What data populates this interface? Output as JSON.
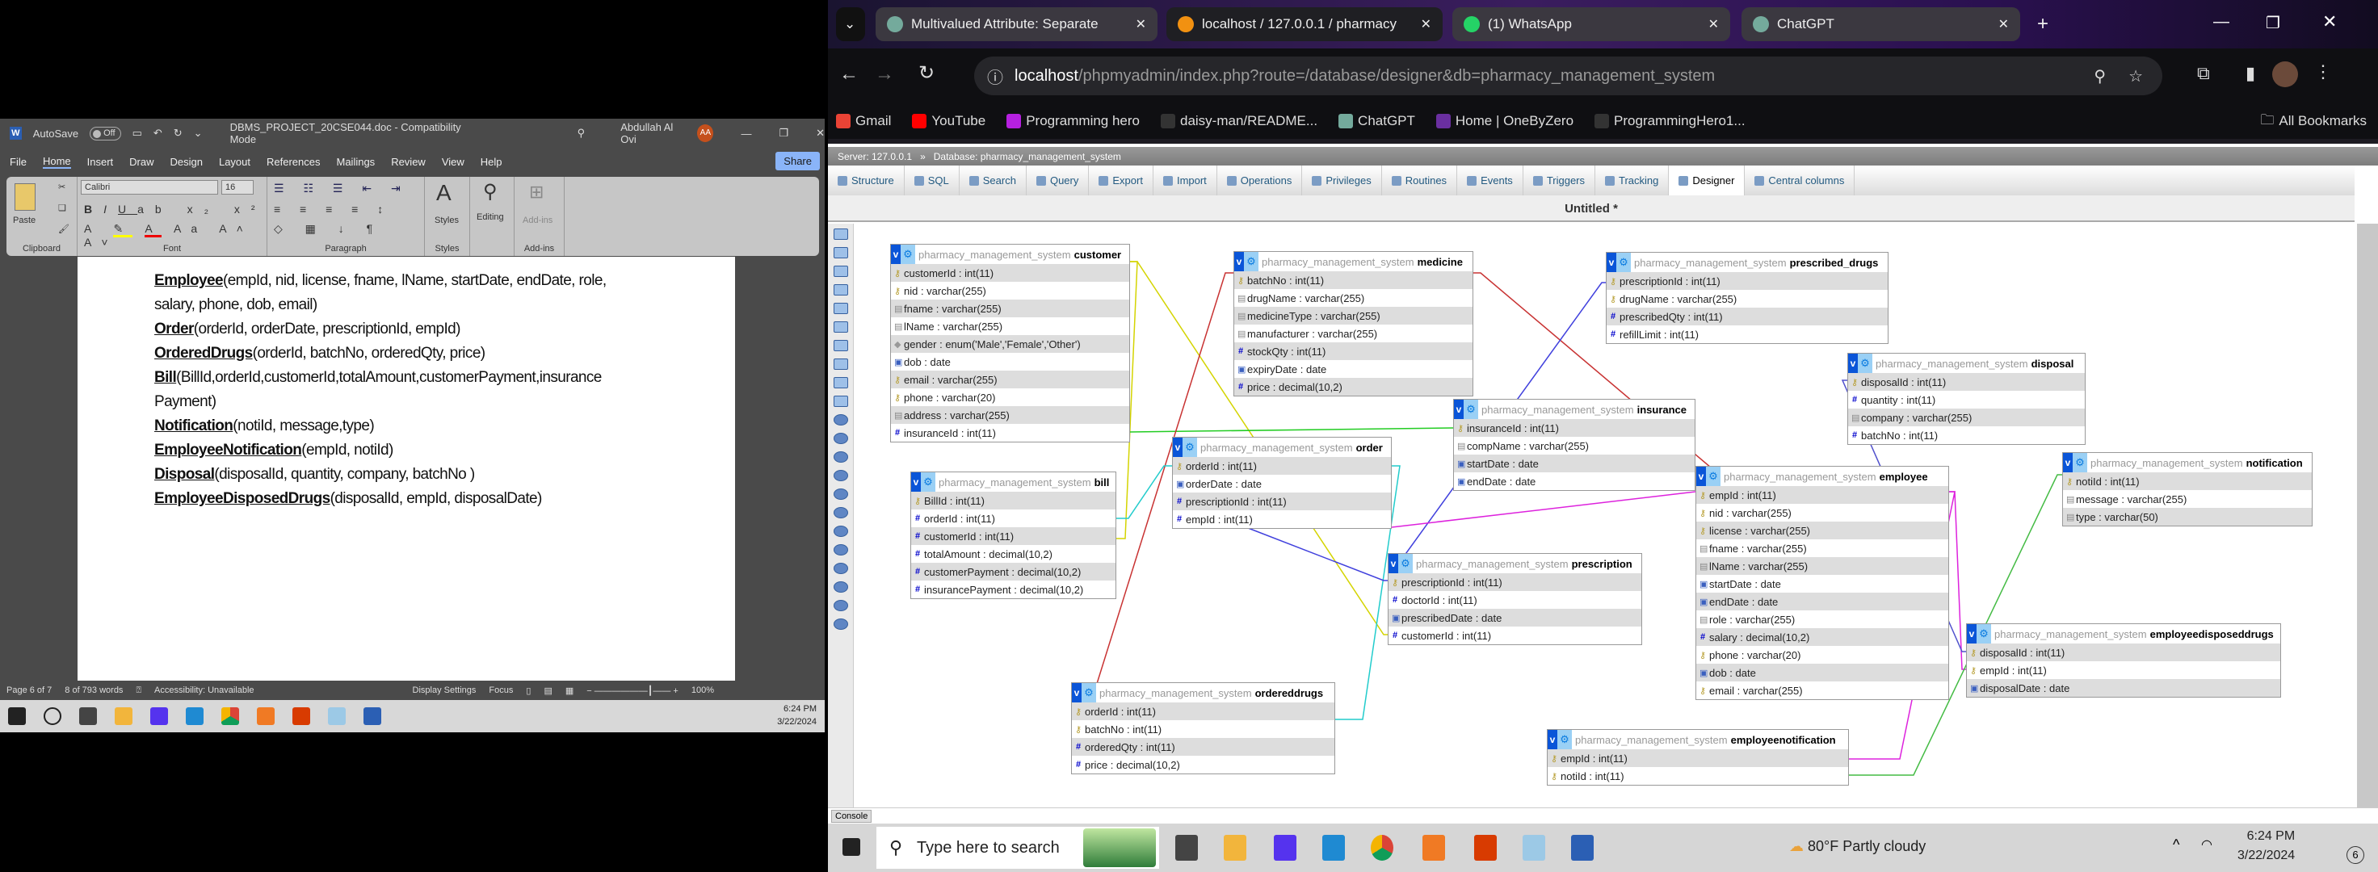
{
  "word": {
    "autosave_label": "AutoSave",
    "autosave_state": "Off",
    "doc_title": "DBMS_PROJECT_20CSE044.doc - Compatibility Mode",
    "user": "Abdullah Al Ovi",
    "user_initials": "AA",
    "menu": [
      "File",
      "Home",
      "Insert",
      "Draw",
      "Design",
      "Layout",
      "References",
      "Mailings",
      "Review",
      "View",
      "Help"
    ],
    "share_label": "Share",
    "ribbon": {
      "paste": "Paste",
      "font_name": "Calibri",
      "font_size": "16",
      "groups": [
        "Clipboard",
        "Font",
        "Paragraph",
        "Styles",
        "Add-ins"
      ],
      "styles": "Styles",
      "editing": "Editing",
      "addins": "Add-ins"
    },
    "doc_lines": [
      {
        "bold": "Employee",
        "text": "(empId, nid, license, fname, lName, startDate, endDate, role,"
      },
      {
        "bold": "",
        "text": "salary, phone, dob, email)"
      },
      {
        "bold": "Order",
        "text": "(orderId, orderDate, prescriptionId, empId)"
      },
      {
        "bold": "OrderedDrugs",
        "text": "(orderId, batchNo, orderedQty, price)"
      },
      {
        "bold": "Bill",
        "text": "(BillId,orderId,customerId,totalAmount,customerPayment,insurance"
      },
      {
        "bold": "",
        "text": "Payment)"
      },
      {
        "bold": "Notification",
        "text": "(notiId, message,type)"
      },
      {
        "bold": "EmployeeNotification",
        "text": "(empId, notiId)"
      },
      {
        "bold": "Disposal",
        "text": "(disposalId, quantity, company, batchNo )"
      },
      {
        "bold": "EmployeeDisposedDrugs",
        "text": "(disposalId, empId, disposalDate)"
      }
    ],
    "status": {
      "page": "Page 6 of 7",
      "words": "8 of 793 words",
      "accessibility": "Accessibility: Unavailable",
      "display_settings": "Display Settings",
      "focus": "Focus",
      "zoom": "100%"
    },
    "taskbar_clock": {
      "time": "6:24 PM",
      "date": "3/22/2024"
    }
  },
  "chrome": {
    "tabs": [
      {
        "title": "Multivalued Attribute: Separate",
        "color": "#74aa9c"
      },
      {
        "title": "localhost / 127.0.0.1 / pharmacy",
        "color": "#f29111"
      },
      {
        "title": "(1) WhatsApp",
        "color": "#25d366"
      },
      {
        "title": "ChatGPT",
        "color": "#74aa9c"
      }
    ],
    "url_host": "localhost",
    "url_rest": "/phpmyadmin/index.php?route=/database/designer&db=pharmacy_management_system",
    "bookmarks": [
      {
        "label": "Gmail",
        "color": "#ea4335"
      },
      {
        "label": "YouTube",
        "color": "#ff0000"
      },
      {
        "label": "Programming hero",
        "color": "#b620e0"
      },
      {
        "label": "daisy-man/README...",
        "color": "#333333"
      },
      {
        "label": "ChatGPT",
        "color": "#74aa9c"
      },
      {
        "label": "Home | OneByZero",
        "color": "#6a2fa0"
      },
      {
        "label": "ProgrammingHero1...",
        "color": "#333333"
      }
    ],
    "all_bookmarks": "All Bookmarks"
  },
  "pma": {
    "server": "Server: 127.0.0.1",
    "database": "Database: pharmacy_management_system",
    "tabs": [
      "Structure",
      "SQL",
      "Search",
      "Query",
      "Export",
      "Import",
      "Operations",
      "Privileges",
      "Routines",
      "Events",
      "Triggers",
      "Tracking",
      "Designer",
      "Central columns"
    ],
    "active_tab": "Designer",
    "designer_title": "Untitled *",
    "console": "Console",
    "toolbar_icons": [
      "toggle-menu-icon",
      "fullscreen-icon",
      "new-page-icon",
      "open-page-icon",
      "edit-icon",
      "save-icon",
      "save-as-icon",
      "delete-page-icon",
      "table-list-icon",
      "relation-icon",
      "reload-icon",
      "help-icon",
      "info-icon",
      "angular-links-icon",
      "snap-grid-icon",
      "small-big-icon",
      "toggle-tables-icon",
      "pdf-export-icon",
      "move-menu-icon",
      "pin-text-icon",
      "export-icon",
      "collapse-icon"
    ],
    "schema_prefix": "pharmacy_management_system",
    "tables": [
      {
        "name": "customer",
        "fields": [
          [
            "key",
            "customerId : int(11)"
          ],
          [
            "key",
            "nid : varchar(255)"
          ],
          [
            "text",
            "fname : varchar(255)"
          ],
          [
            "text",
            "lName : varchar(255)"
          ],
          [
            "enum",
            "gender : enum('Male','Female','Other')"
          ],
          [
            "date",
            "dob : date"
          ],
          [
            "key",
            "email : varchar(255)"
          ],
          [
            "key",
            "phone : varchar(20)"
          ],
          [
            "text",
            "address : varchar(255)"
          ],
          [
            "hash",
            "insuranceId : int(11)"
          ]
        ]
      },
      {
        "name": "medicine",
        "fields": [
          [
            "key",
            "batchNo : int(11)"
          ],
          [
            "text",
            "drugName : varchar(255)"
          ],
          [
            "text",
            "medicineType : varchar(255)"
          ],
          [
            "text",
            "manufacturer : varchar(255)"
          ],
          [
            "hash",
            "stockQty : int(11)"
          ],
          [
            "date",
            "expiryDate : date"
          ],
          [
            "hash",
            "price : decimal(10,2)"
          ]
        ]
      },
      {
        "name": "prescribed_drugs",
        "fields": [
          [
            "key",
            "prescriptionId : int(11)"
          ],
          [
            "key",
            "drugName : varchar(255)"
          ],
          [
            "hash",
            "prescribedQty : int(11)"
          ],
          [
            "hash",
            "refillLimit : int(11)"
          ]
        ]
      },
      {
        "name": "disposal",
        "fields": [
          [
            "key",
            "disposalId : int(11)"
          ],
          [
            "hash",
            "quantity : int(11)"
          ],
          [
            "text",
            "company : varchar(255)"
          ],
          [
            "hash",
            "batchNo : int(11)"
          ]
        ]
      },
      {
        "name": "insurance",
        "fields": [
          [
            "key",
            "insuranceId : int(11)"
          ],
          [
            "text",
            "compName : varchar(255)"
          ],
          [
            "date",
            "startDate : date"
          ],
          [
            "date",
            "endDate : date"
          ]
        ]
      },
      {
        "name": "order",
        "fields": [
          [
            "key",
            "orderId : int(11)"
          ],
          [
            "date",
            "orderDate : date"
          ],
          [
            "hash",
            "prescriptionId : int(11)"
          ],
          [
            "hash",
            "empId : int(11)"
          ]
        ]
      },
      {
        "name": "bill",
        "fields": [
          [
            "key",
            "BillId : int(11)"
          ],
          [
            "hash",
            "orderId : int(11)"
          ],
          [
            "hash",
            "customerId : int(11)"
          ],
          [
            "hash",
            "totalAmount : decimal(10,2)"
          ],
          [
            "hash",
            "customerPayment : decimal(10,2)"
          ],
          [
            "hash",
            "insurancePayment : decimal(10,2)"
          ]
        ]
      },
      {
        "name": "notification",
        "fields": [
          [
            "key",
            "notiId : int(11)"
          ],
          [
            "text",
            "message : varchar(255)"
          ],
          [
            "text",
            "type : varchar(50)"
          ]
        ]
      },
      {
        "name": "employee",
        "fields": [
          [
            "key",
            "empId : int(11)"
          ],
          [
            "key",
            "nid : varchar(255)"
          ],
          [
            "key",
            "license : varchar(255)"
          ],
          [
            "text",
            "fname : varchar(255)"
          ],
          [
            "text",
            "lName : varchar(255)"
          ],
          [
            "date",
            "startDate : date"
          ],
          [
            "date",
            "endDate : date"
          ],
          [
            "text",
            "role : varchar(255)"
          ],
          [
            "hash",
            "salary : decimal(10,2)"
          ],
          [
            "key",
            "phone : varchar(20)"
          ],
          [
            "date",
            "dob : date"
          ],
          [
            "key",
            "email : varchar(255)"
          ]
        ]
      },
      {
        "name": "prescription",
        "fields": [
          [
            "key",
            "prescriptionId : int(11)"
          ],
          [
            "hash",
            "doctorId : int(11)"
          ],
          [
            "date",
            "prescribedDate : date"
          ],
          [
            "hash",
            "customerId : int(11)"
          ]
        ]
      },
      {
        "name": "employeedisposeddrugs",
        "fields": [
          [
            "key",
            "disposalId : int(11)"
          ],
          [
            "key",
            "empId : int(11)"
          ],
          [
            "date",
            "disposalDate : date"
          ]
        ]
      },
      {
        "name": "ordereddrugs",
        "fields": [
          [
            "key",
            "orderId : int(11)"
          ],
          [
            "key",
            "batchNo : int(11)"
          ],
          [
            "hash",
            "orderedQty : int(11)"
          ],
          [
            "hash",
            "price : decimal(10,2)"
          ]
        ]
      },
      {
        "name": "employeenotification",
        "fields": [
          [
            "key",
            "empId : int(11)"
          ],
          [
            "key",
            "notiId : int(11)"
          ]
        ]
      }
    ]
  },
  "taskbar": {
    "search_placeholder": "Type here to search",
    "weather": "80°F  Partly cloudy",
    "time": "6:24 PM",
    "date": "3/22/2024",
    "notifications": "6"
  }
}
